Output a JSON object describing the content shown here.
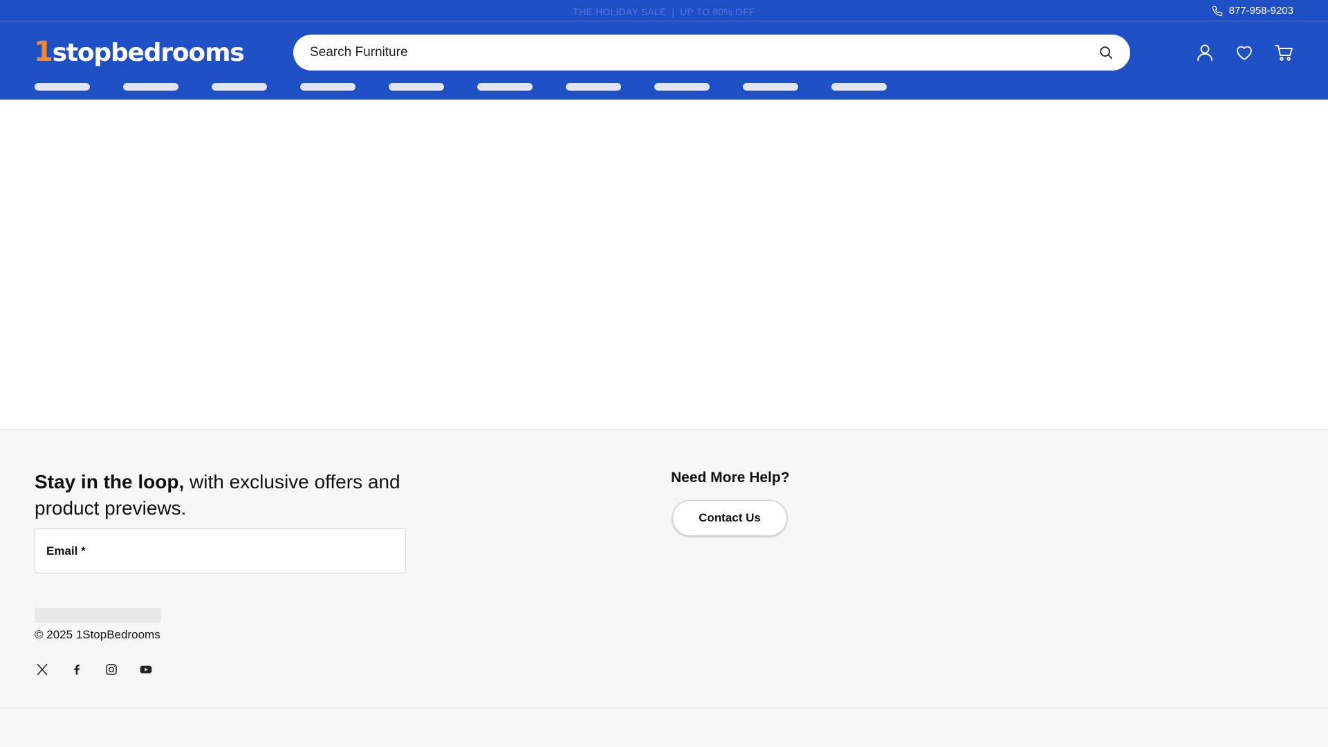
{
  "colors": {
    "header_bg": "#1f4fc4",
    "logo_accent": "#f5872b",
    "footer_bg": "#f7f7f7"
  },
  "topbar": {
    "promo_left": "THE HOLIDAY SALE",
    "promo_separator": "|",
    "promo_right": "UP TO 80% OFF",
    "phone": "877-958-9203",
    "phone_icon": "phone-icon"
  },
  "logo": {
    "one": "1",
    "text": "stopbedrooms"
  },
  "search": {
    "placeholder": "Search Furniture",
    "icon": "search-icon"
  },
  "header_icons": [
    "user-icon",
    "heart-icon",
    "cart-icon"
  ],
  "footer": {
    "newsletter_bold": "Stay in the loop,",
    "newsletter_rest": " with exclusive offers and product previews.",
    "email_label": "Email *",
    "help_title": "Need More Help?",
    "contact_label": "Contact Us",
    "copyright": "© 2025 1StopBedrooms",
    "social_icons": [
      "x-icon",
      "facebook-icon",
      "instagram-icon",
      "youtube-icon"
    ]
  }
}
